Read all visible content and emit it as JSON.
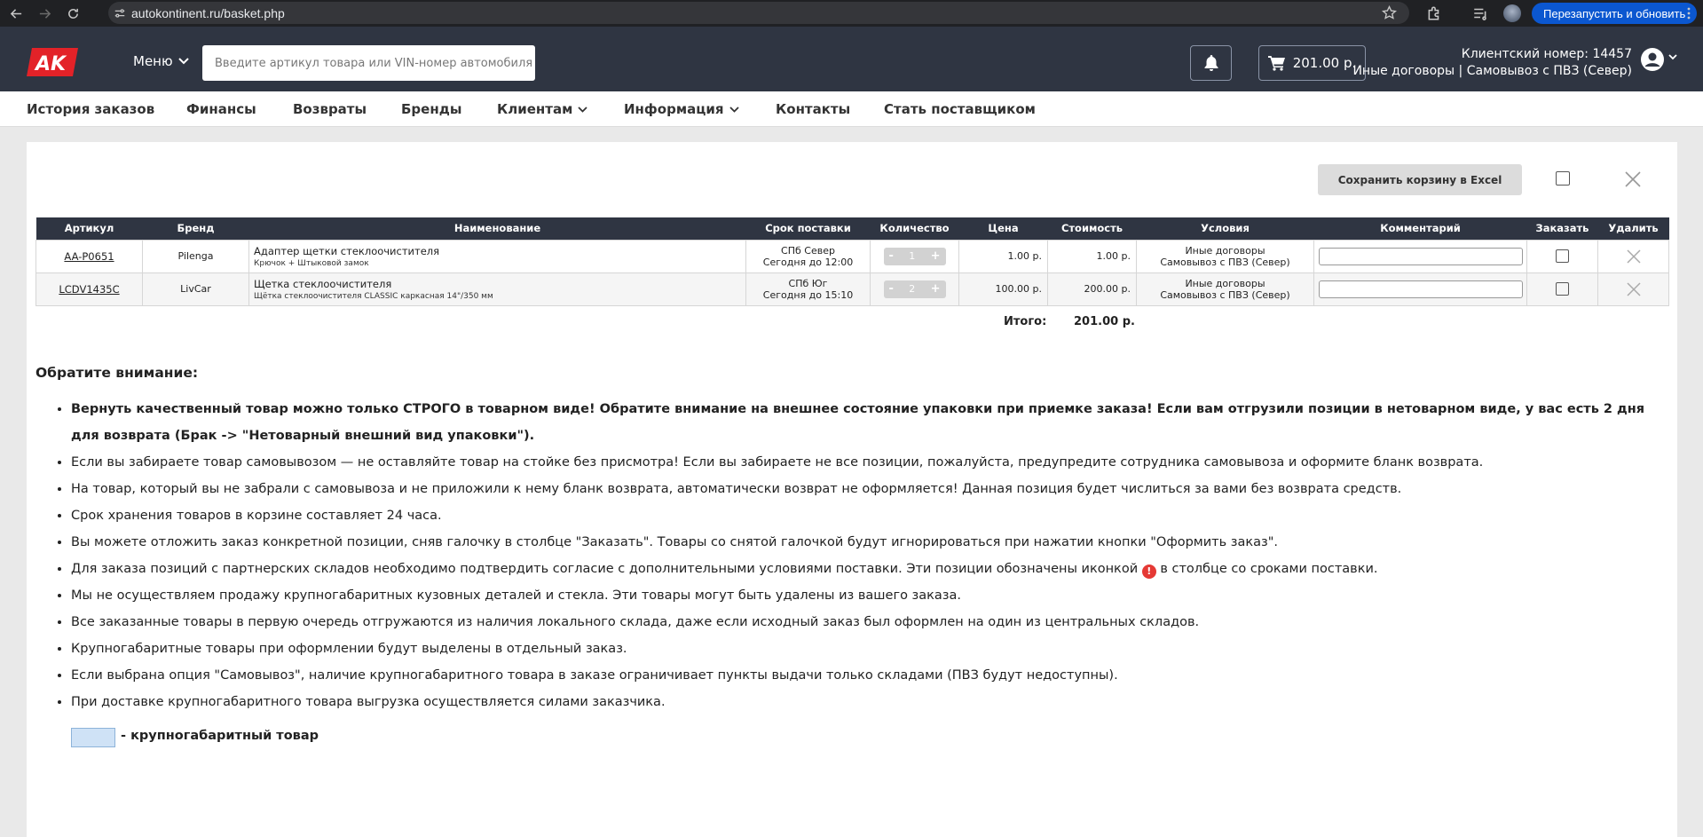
{
  "browser": {
    "url": "autokontinent.ru/basket.php",
    "relaunch_label": "Перезапустить и обновить"
  },
  "header": {
    "logo_text": "AK",
    "menu_label": "Меню",
    "search_placeholder": "Введите артикул товара или VIN-номер автомобиля",
    "cart_total": "201.00 р.",
    "client_number": "Клиентский номер: 14457",
    "client_contract": "Иные договоры | Самовывоз с ПВЗ (Север)"
  },
  "nav": {
    "items": [
      {
        "label": "История заказов"
      },
      {
        "label": "Финансы"
      },
      {
        "label": "Возвраты"
      },
      {
        "label": "Бренды"
      },
      {
        "label": "Клиентам"
      },
      {
        "label": "Информация"
      },
      {
        "label": "Контакты"
      },
      {
        "label": "Стать поставщиком"
      }
    ]
  },
  "basket": {
    "excel_button": "Сохранить корзину в Excel",
    "columns": [
      "Артикул",
      "Бренд",
      "Наименование",
      "Срок поставки",
      "Количество",
      "Цена",
      "Стоимость",
      "Условия",
      "Комментарий",
      "Заказать",
      "Удалить"
    ],
    "rows": [
      {
        "article": "AA-P0651",
        "brand": "Pilenga",
        "name": "Адаптер щетки стеклоочистителя",
        "name_sub": "Крючок + Штыковой замок",
        "delivery_place": "СПб Север",
        "delivery_time": "Сегодня до 12:00",
        "qty": "1",
        "price": "1.00 р.",
        "cost": "1.00 р.",
        "terms_1": "Иные договоры",
        "terms_2": "Самовывоз с ПВЗ (Север)"
      },
      {
        "article": "LCDV1435C",
        "brand": "LivCar",
        "name": "Щетка стеклоочистителя",
        "name_sub": "Щётка стеклоочистителя CLASSIC каркасная 14\"/350 мм",
        "delivery_place": "СПб Юг",
        "delivery_time": "Сегодня до 15:10",
        "qty": "2",
        "price": "100.00 р.",
        "cost": "200.00 р.",
        "terms_1": "Иные договоры",
        "terms_2": "Самовывоз с ПВЗ (Север)"
      }
    ],
    "qty_minus": "-",
    "qty_plus": "+",
    "total_label": "Итого:",
    "total_value": "201.00 р."
  },
  "notes": {
    "title": "Обратите внимание:",
    "items": [
      "Вернуть качественный товар можно только СТРОГО в товарном виде! Обратите внимание на внешнее состояние упаковки при приемке заказа! Если вам отгрузили позиции в нетоварном виде, у вас есть 2 дня для возврата (Брак -> \"Нетоварный внешний вид упаковки\").",
      "Если вы забираете товар самовывозом — не оставляйте товар на стойке без присмотра! Если вы забираете не все позиции, пожалуйста, предупредите сотрудника самовывоза и оформите бланк возврата.",
      "На товар, который вы не забрали с самовывоза и не приложили к нему бланк возврата, автоматически возврат не оформляется! Данная позиция будет числиться за вами без возврата средств.",
      "Срок хранения товаров в корзине составляет 24 часа.",
      "Вы можете отложить заказ конкретной позиции, сняв галочку в столбце \"Заказать\". Товары со снятой галочкой будут игнорироваться при нажатии кнопки \"Оформить заказ\".",
      "Для заказа позиций с партнерских складов необходимо подтвердить согласие с дополнительными условиями поставки. Эти позиции обозначены иконкой",
      "Мы не осуществляем продажу крупногабаритных кузовных деталей и стекла. Эти товары могут быть удалены из вашего заказа.",
      "Все заказанные товары в первую очередь отгружаются из наличия локального склада, даже если исходный заказ был оформлен на один из центральных складов.",
      "Крупногабаритные товары при оформлении будут выделены в отдельный заказ.",
      "Если выбрана опция \"Самовывоз\", наличие крупногабаритного товара в заказе ограничивает пункты выдачи только складами (ПВЗ будут недоступны).",
      "При доставке крупногабаритного товара выгрузка осуществляется силами заказчика."
    ],
    "item6_suffix": "в столбце со сроками поставки.",
    "warn_glyph": "!",
    "legend": "- крупногабаритный товар"
  }
}
